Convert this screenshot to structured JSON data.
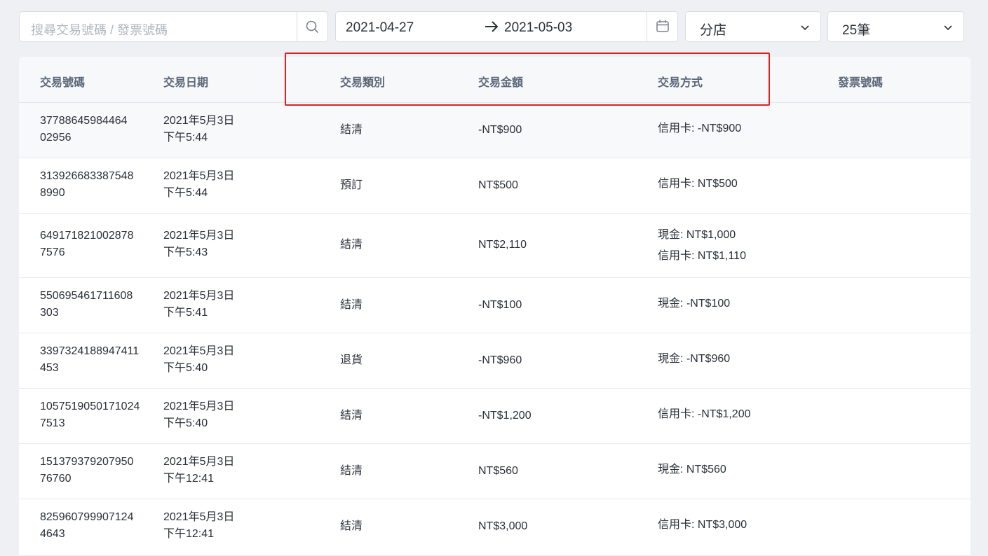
{
  "toolbar": {
    "search_placeholder": "搜尋交易號碼 / 發票號碼",
    "date_start": "2021-04-27",
    "date_end": "2021-05-03",
    "branch_select": "分店",
    "page_size_select": "25筆"
  },
  "table": {
    "headers": {
      "id": "交易號碼",
      "date": "交易日期",
      "type": "交易類別",
      "amount": "交易金額",
      "payment": "交易方式",
      "invoice": "發票號碼"
    },
    "rows": [
      {
        "id_line1": "37788645984464",
        "id_line2": "02956",
        "date_line1": "2021年5月3日",
        "date_line2": "下午5:44",
        "type": "結清",
        "amount": "-NT$900",
        "payment_line1": "信用卡: -NT$900",
        "payment_line2": "",
        "invoice": ""
      },
      {
        "id_line1": "313926683387548",
        "id_line2": "8990",
        "date_line1": "2021年5月3日",
        "date_line2": "下午5:44",
        "type": "預訂",
        "amount": "NT$500",
        "payment_line1": "信用卡: NT$500",
        "payment_line2": "",
        "invoice": ""
      },
      {
        "id_line1": "649171821002878",
        "id_line2": "7576",
        "date_line1": "2021年5月3日",
        "date_line2": "下午5:43",
        "type": "結清",
        "amount": "NT$2,110",
        "payment_line1": "現金: NT$1,000",
        "payment_line2": "信用卡: NT$1,110",
        "invoice": ""
      },
      {
        "id_line1": "550695461711608",
        "id_line2": "303",
        "date_line1": "2021年5月3日",
        "date_line2": "下午5:41",
        "type": "結清",
        "amount": "-NT$100",
        "payment_line1": "現金: -NT$100",
        "payment_line2": "",
        "invoice": ""
      },
      {
        "id_line1": "3397324188947411",
        "id_line2": "453",
        "date_line1": "2021年5月3日",
        "date_line2": "下午5:40",
        "type": "退貨",
        "amount": "-NT$960",
        "payment_line1": "現金: -NT$960",
        "payment_line2": "",
        "invoice": ""
      },
      {
        "id_line1": "105751905017102​4",
        "id_line2": "7513",
        "date_line1": "2021年5月3日",
        "date_line2": "下午5:40",
        "type": "結清",
        "amount": "-NT$1,200",
        "payment_line1": "信用卡: -NT$1,200",
        "payment_line2": "",
        "invoice": ""
      },
      {
        "id_line1": "151379379207950",
        "id_line2": "76760",
        "date_line1": "2021年5月3日",
        "date_line2": "下午12:41",
        "type": "結清",
        "amount": "NT$560",
        "payment_line1": "現金: NT$560",
        "payment_line2": "",
        "invoice": ""
      },
      {
        "id_line1": "825960799907124",
        "id_line2": "4643",
        "date_line1": "2021年5月3日",
        "date_line2": "下午12:41",
        "type": "結清",
        "amount": "NT$3,000",
        "payment_line1": "信用卡: NT$3,000",
        "payment_line2": "",
        "invoice": ""
      }
    ]
  },
  "icons": {
    "search": "search-icon",
    "arrow": "arrow-right-icon",
    "calendar": "calendar-icon",
    "chevron": "chevron-down-icon"
  },
  "colors": {
    "highlight": "#e02020",
    "header_text": "#5b6678",
    "background": "#eef0f3"
  }
}
